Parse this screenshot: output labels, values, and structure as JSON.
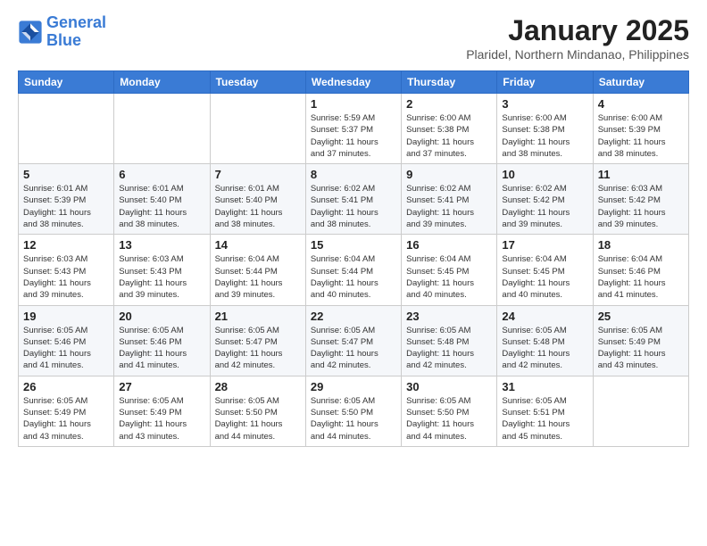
{
  "logo": {
    "line1": "General",
    "line2": "Blue"
  },
  "title": "January 2025",
  "location": "Plaridel, Northern Mindanao, Philippines",
  "weekdays": [
    "Sunday",
    "Monday",
    "Tuesday",
    "Wednesday",
    "Thursday",
    "Friday",
    "Saturday"
  ],
  "weeks": [
    [
      {
        "day": "",
        "info": ""
      },
      {
        "day": "",
        "info": ""
      },
      {
        "day": "",
        "info": ""
      },
      {
        "day": "1",
        "info": "Sunrise: 5:59 AM\nSunset: 5:37 PM\nDaylight: 11 hours\nand 37 minutes."
      },
      {
        "day": "2",
        "info": "Sunrise: 6:00 AM\nSunset: 5:38 PM\nDaylight: 11 hours\nand 37 minutes."
      },
      {
        "day": "3",
        "info": "Sunrise: 6:00 AM\nSunset: 5:38 PM\nDaylight: 11 hours\nand 38 minutes."
      },
      {
        "day": "4",
        "info": "Sunrise: 6:00 AM\nSunset: 5:39 PM\nDaylight: 11 hours\nand 38 minutes."
      }
    ],
    [
      {
        "day": "5",
        "info": "Sunrise: 6:01 AM\nSunset: 5:39 PM\nDaylight: 11 hours\nand 38 minutes."
      },
      {
        "day": "6",
        "info": "Sunrise: 6:01 AM\nSunset: 5:40 PM\nDaylight: 11 hours\nand 38 minutes."
      },
      {
        "day": "7",
        "info": "Sunrise: 6:01 AM\nSunset: 5:40 PM\nDaylight: 11 hours\nand 38 minutes."
      },
      {
        "day": "8",
        "info": "Sunrise: 6:02 AM\nSunset: 5:41 PM\nDaylight: 11 hours\nand 38 minutes."
      },
      {
        "day": "9",
        "info": "Sunrise: 6:02 AM\nSunset: 5:41 PM\nDaylight: 11 hours\nand 39 minutes."
      },
      {
        "day": "10",
        "info": "Sunrise: 6:02 AM\nSunset: 5:42 PM\nDaylight: 11 hours\nand 39 minutes."
      },
      {
        "day": "11",
        "info": "Sunrise: 6:03 AM\nSunset: 5:42 PM\nDaylight: 11 hours\nand 39 minutes."
      }
    ],
    [
      {
        "day": "12",
        "info": "Sunrise: 6:03 AM\nSunset: 5:43 PM\nDaylight: 11 hours\nand 39 minutes."
      },
      {
        "day": "13",
        "info": "Sunrise: 6:03 AM\nSunset: 5:43 PM\nDaylight: 11 hours\nand 39 minutes."
      },
      {
        "day": "14",
        "info": "Sunrise: 6:04 AM\nSunset: 5:44 PM\nDaylight: 11 hours\nand 39 minutes."
      },
      {
        "day": "15",
        "info": "Sunrise: 6:04 AM\nSunset: 5:44 PM\nDaylight: 11 hours\nand 40 minutes."
      },
      {
        "day": "16",
        "info": "Sunrise: 6:04 AM\nSunset: 5:45 PM\nDaylight: 11 hours\nand 40 minutes."
      },
      {
        "day": "17",
        "info": "Sunrise: 6:04 AM\nSunset: 5:45 PM\nDaylight: 11 hours\nand 40 minutes."
      },
      {
        "day": "18",
        "info": "Sunrise: 6:04 AM\nSunset: 5:46 PM\nDaylight: 11 hours\nand 41 minutes."
      }
    ],
    [
      {
        "day": "19",
        "info": "Sunrise: 6:05 AM\nSunset: 5:46 PM\nDaylight: 11 hours\nand 41 minutes."
      },
      {
        "day": "20",
        "info": "Sunrise: 6:05 AM\nSunset: 5:46 PM\nDaylight: 11 hours\nand 41 minutes."
      },
      {
        "day": "21",
        "info": "Sunrise: 6:05 AM\nSunset: 5:47 PM\nDaylight: 11 hours\nand 42 minutes."
      },
      {
        "day": "22",
        "info": "Sunrise: 6:05 AM\nSunset: 5:47 PM\nDaylight: 11 hours\nand 42 minutes."
      },
      {
        "day": "23",
        "info": "Sunrise: 6:05 AM\nSunset: 5:48 PM\nDaylight: 11 hours\nand 42 minutes."
      },
      {
        "day": "24",
        "info": "Sunrise: 6:05 AM\nSunset: 5:48 PM\nDaylight: 11 hours\nand 42 minutes."
      },
      {
        "day": "25",
        "info": "Sunrise: 6:05 AM\nSunset: 5:49 PM\nDaylight: 11 hours\nand 43 minutes."
      }
    ],
    [
      {
        "day": "26",
        "info": "Sunrise: 6:05 AM\nSunset: 5:49 PM\nDaylight: 11 hours\nand 43 minutes."
      },
      {
        "day": "27",
        "info": "Sunrise: 6:05 AM\nSunset: 5:49 PM\nDaylight: 11 hours\nand 43 minutes."
      },
      {
        "day": "28",
        "info": "Sunrise: 6:05 AM\nSunset: 5:50 PM\nDaylight: 11 hours\nand 44 minutes."
      },
      {
        "day": "29",
        "info": "Sunrise: 6:05 AM\nSunset: 5:50 PM\nDaylight: 11 hours\nand 44 minutes."
      },
      {
        "day": "30",
        "info": "Sunrise: 6:05 AM\nSunset: 5:50 PM\nDaylight: 11 hours\nand 44 minutes."
      },
      {
        "day": "31",
        "info": "Sunrise: 6:05 AM\nSunset: 5:51 PM\nDaylight: 11 hours\nand 45 minutes."
      },
      {
        "day": "",
        "info": ""
      }
    ]
  ]
}
